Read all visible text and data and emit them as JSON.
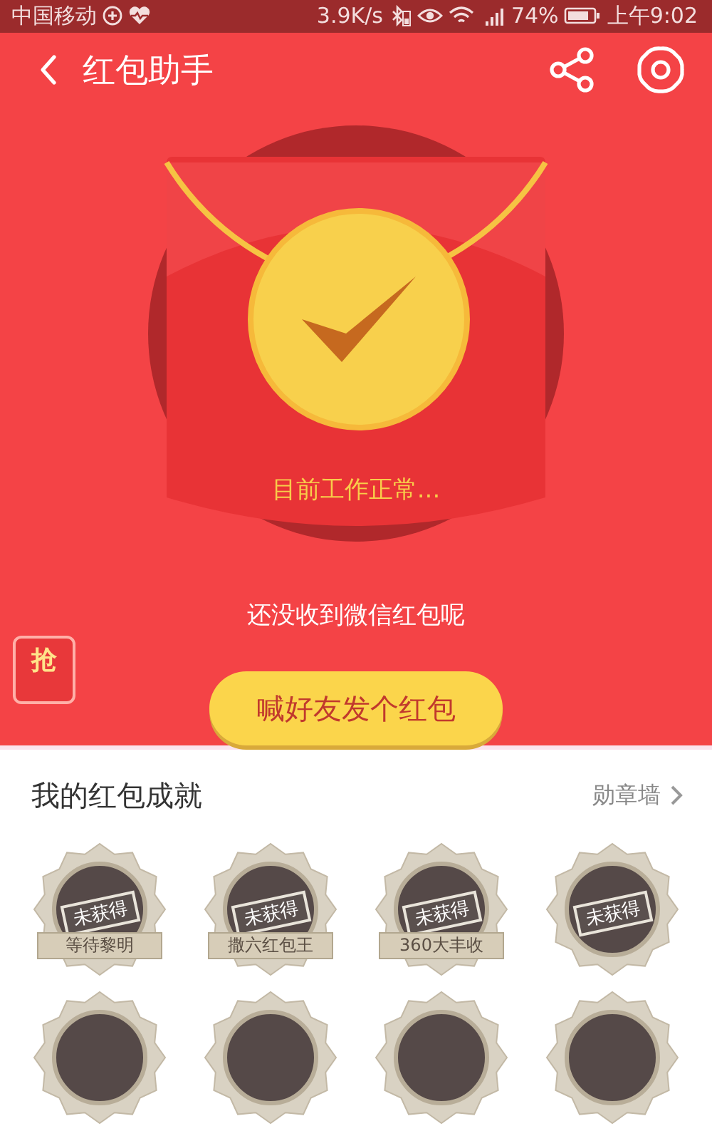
{
  "status_bar": {
    "carrier": "中国移动",
    "network_speed": "3.9K/s",
    "battery": "74%",
    "time": "上午9:02"
  },
  "header": {
    "title": "红包助手"
  },
  "envelope": {
    "status": "目前工作正常..."
  },
  "message": "还没收到微信红包呢",
  "floating_badge": {
    "text": "抢"
  },
  "action_button": {
    "label": "喊好友发个红包"
  },
  "achievements": {
    "title": "我的红包成就",
    "link": "勋章墙",
    "badges": [
      {
        "kind": "full",
        "stamp": "未获得",
        "label": "等待黎明"
      },
      {
        "kind": "full",
        "stamp": "未获得",
        "label": "撒六红包王"
      },
      {
        "kind": "full",
        "stamp": "未获得",
        "label": "360大丰收"
      },
      {
        "kind": "stamp_only",
        "stamp": "未获得"
      },
      {
        "kind": "cut"
      },
      {
        "kind": "cut"
      },
      {
        "kind": "cut"
      },
      {
        "kind": "cut"
      }
    ]
  }
}
